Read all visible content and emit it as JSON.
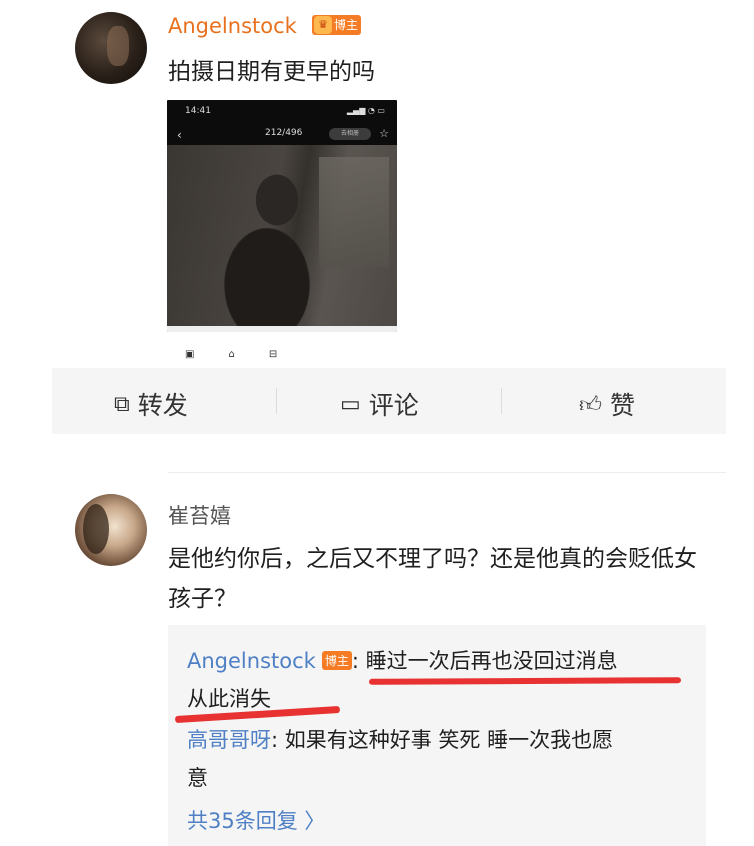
{
  "post": {
    "username": "Angelnstock",
    "badge_label": "博主",
    "text": "拍摄日期有更早的吗",
    "screenshot": {
      "status_time": "14:41",
      "counter": "212/496",
      "pill_label": "去相册"
    }
  },
  "actions": {
    "repost_label": "转发",
    "comment_label": "评论",
    "like_label": "赞"
  },
  "comment": {
    "username": "崔苔嬉",
    "text": "是他约你后，之后又不理了吗？还是他真的会贬低女孩子？",
    "replies": [
      {
        "user": "Angelnstock",
        "badge": "博主",
        "text": ": 睡过一次后再也没回过消息",
        "text_cont": "从此消失"
      },
      {
        "user": "高哥哥呀",
        "text": ": 如果有这种好事 笑死 睡一次我也愿",
        "text_cont": "意"
      }
    ],
    "more_replies": "共35条回复 〉"
  },
  "colors": {
    "orange_username": "#e8711f",
    "badge_orange": "#f57c24",
    "link_blue": "#4f80c5",
    "highlight_red": "#e83131"
  },
  "icons": [
    "repost-icon",
    "comment-icon",
    "like-icon",
    "crown-icon"
  ]
}
